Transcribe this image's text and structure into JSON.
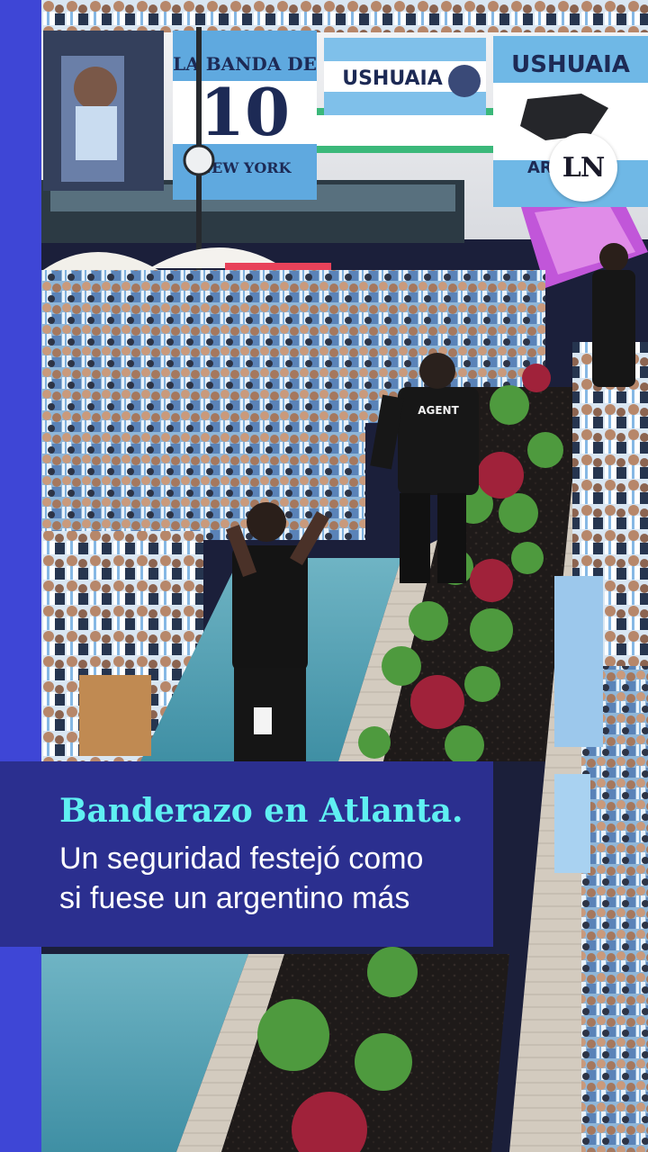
{
  "logo": {
    "text": "LN",
    "brand_color": "#ffffff"
  },
  "caption": {
    "title": "Banderazo en Atlanta.",
    "line1": "Un seguridad festejó como",
    "line2": "si fuese un argentino más",
    "title_color": "#5ff0f2",
    "background_color": "#2b2f8f"
  },
  "accent_band_color": "#3e46d6",
  "banners": {
    "left_text": "LA BANDA DE 10 NEW YORK",
    "center_text": "USHUAIA",
    "right_text": "USHUAIA"
  },
  "guard_vest": "AGENT"
}
